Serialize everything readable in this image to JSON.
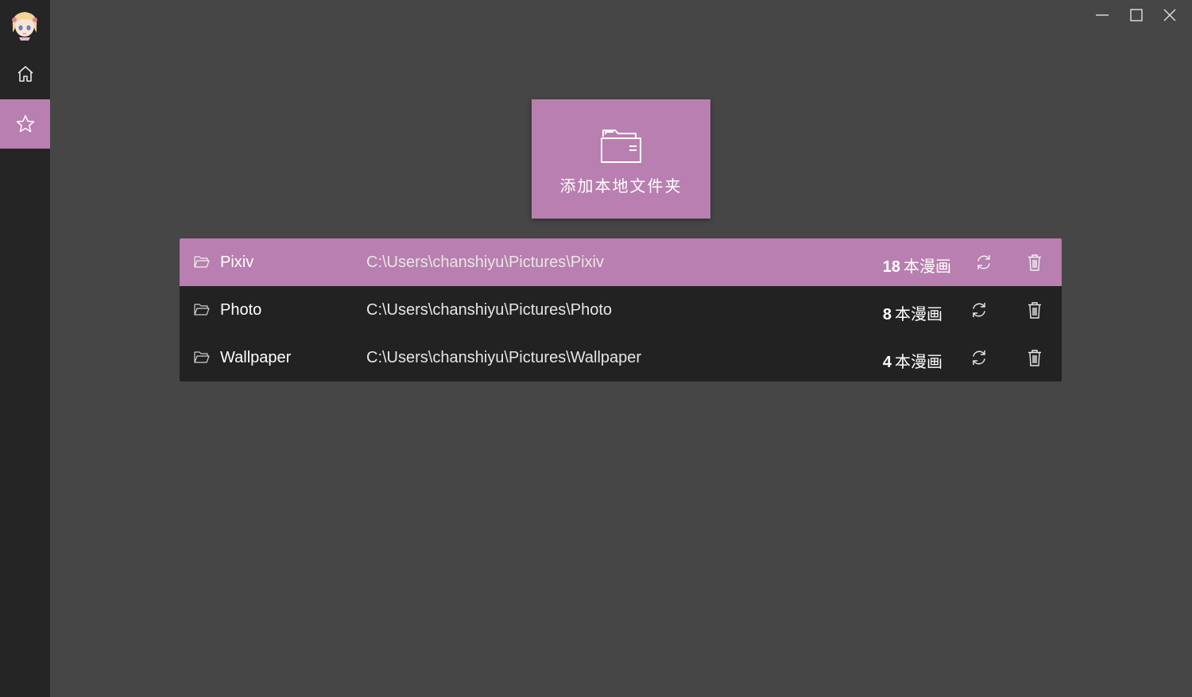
{
  "theme": {
    "accent": "#b97fb0",
    "sidebar_bg": "#252525",
    "content_bg": "#464646",
    "list_bg": "#222222"
  },
  "sidebar": {
    "avatar_icon": "anime-avatar",
    "items": [
      {
        "id": "home",
        "icon": "home-icon",
        "active": false
      },
      {
        "id": "library",
        "icon": "star-icon",
        "active": true
      }
    ]
  },
  "window_controls": {
    "minimize_icon": "minimize-icon",
    "maximize_icon": "maximize-icon",
    "close_icon": "close-icon"
  },
  "add_card": {
    "label": "添加本地文件夹",
    "icon": "folder-add-icon"
  },
  "folders": [
    {
      "name": "Pixiv",
      "path": "C:\\Users\\chanshiyu\\Pictures\\Pixiv",
      "count": "18",
      "unit": "本漫画",
      "selected": true
    },
    {
      "name": "Photo",
      "path": "C:\\Users\\chanshiyu\\Pictures\\Photo",
      "count": "8",
      "unit": "本漫画",
      "selected": false
    },
    {
      "name": "Wallpaper",
      "path": "C:\\Users\\chanshiyu\\Pictures\\Wallpaper",
      "count": "4",
      "unit": "本漫画",
      "selected": false
    }
  ]
}
